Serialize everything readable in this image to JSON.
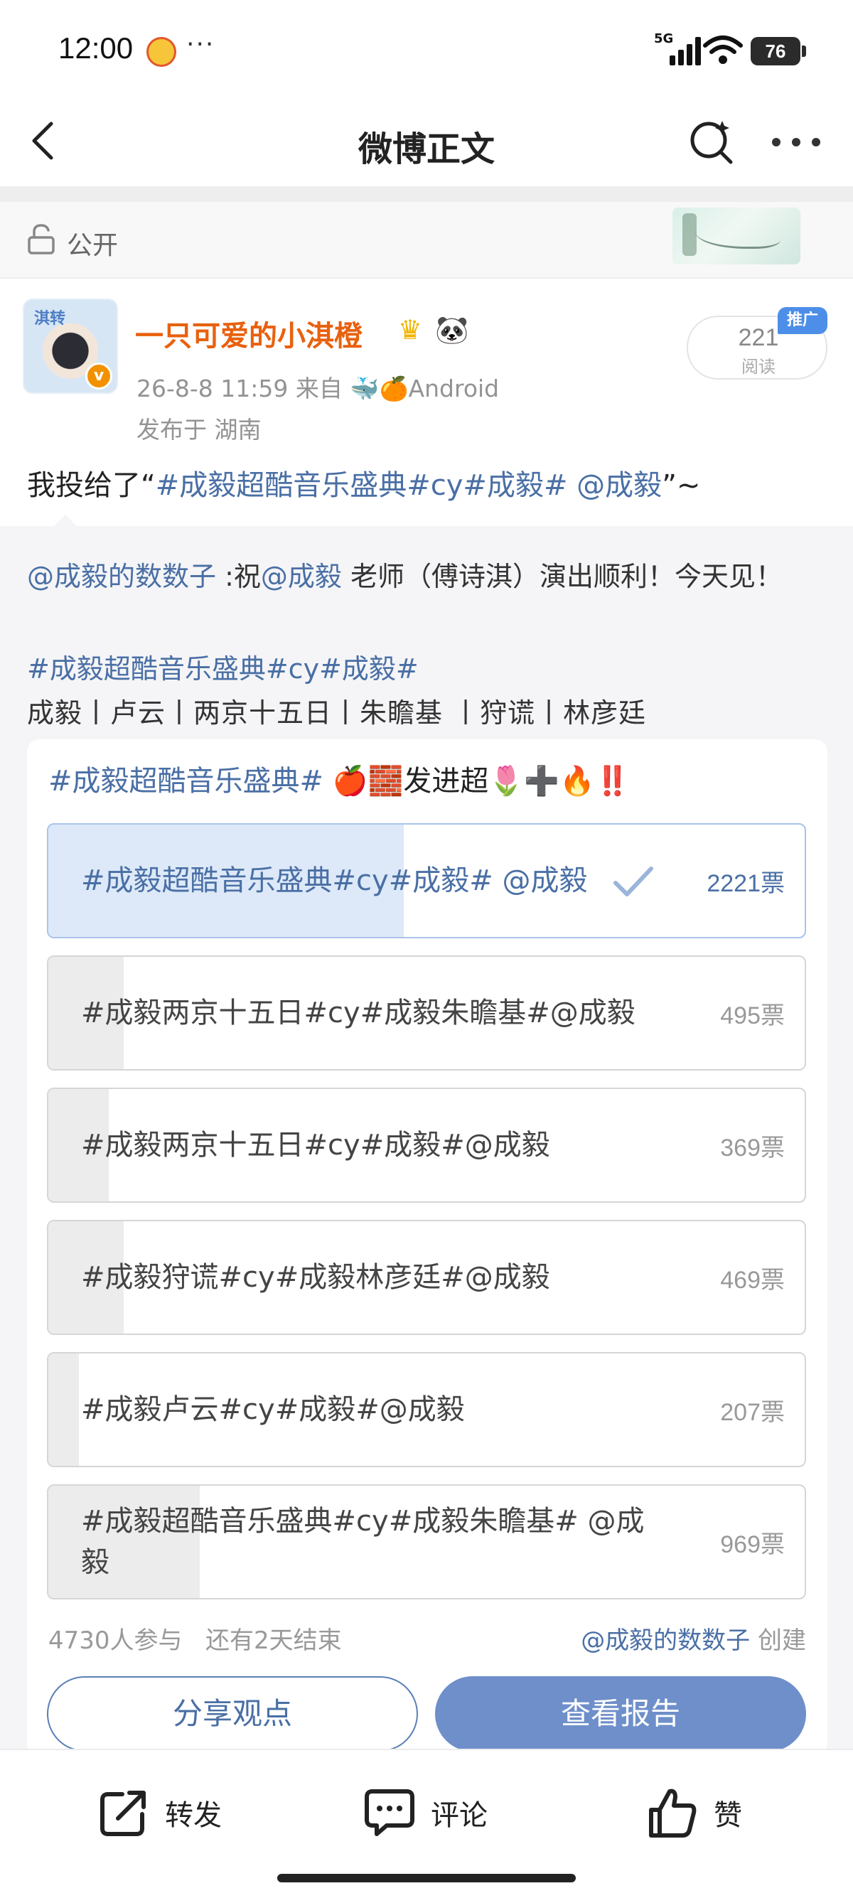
{
  "status_bar": {
    "time": "12:00",
    "dots": "···",
    "network": "5G",
    "battery": "76"
  },
  "nav": {
    "title": "微博正文"
  },
  "visibility": {
    "label": "公开"
  },
  "author": {
    "name": "一只可爱的小淇橙",
    "avatar_text": "淇转",
    "verified": "v",
    "meta": "26-8-8 11:59   来自 🐳🍊Android",
    "location": "发布于 湖南",
    "reads": "221",
    "reads_label": "阅读",
    "promo": "推广"
  },
  "post": {
    "prefix": "我投给了“",
    "link": "#成毅超酷音乐盛典#cy#成毅# @成毅",
    "suffix": "”~"
  },
  "repost": {
    "line1_mention": "@成毅的数数子",
    "line1_a": " :祝",
    "line1_mention2": "@成毅",
    "line1_b": " 老师（傅诗淇）演出顺利！今天见！",
    "tags": "#成毅超酷音乐盛典#cy#成毅#",
    "names": "成毅丨卢云丨两京十五日丨朱瞻基 丨狩谎丨林彦廷"
  },
  "poll": {
    "title_tag": "#成毅超酷音乐盛典#",
    "title_rest": " 🍎🧱发进超🌷➕🔥‼️",
    "options": [
      {
        "text": "#成毅超酷音乐盛典#cy#成毅# @成毅",
        "votes": "2221票",
        "share": 0.47,
        "selected": true
      },
      {
        "text": "#成毅两京十五日#cy#成毅朱瞻基#@成毅",
        "votes": "495票",
        "share": 0.1,
        "selected": false
      },
      {
        "text": "#成毅两京十五日#cy#成毅#@成毅",
        "votes": "369票",
        "share": 0.08,
        "selected": false
      },
      {
        "text": "#成毅狩谎#cy#成毅林彦廷#@成毅",
        "votes": "469票",
        "share": 0.1,
        "selected": false
      },
      {
        "text": "#成毅卢云#cy#成毅#@成毅",
        "votes": "207票",
        "share": 0.04,
        "selected": false
      },
      {
        "text": "#成毅超酷音乐盛典#cy#成毅朱瞻基# @成毅",
        "votes": "969票",
        "share": 0.2,
        "selected": false
      }
    ],
    "participants": "4730人参与",
    "remaining": "还有2天结束",
    "creator": "@成毅的数数子",
    "creator_suffix": " 创建",
    "share_button": "分享观点",
    "report_button": "查看报告"
  },
  "actions": {
    "repost": "转发",
    "comment": "评论",
    "like": "赞"
  },
  "colors": {
    "link": "#4a6fa5",
    "username": "#e8610e",
    "report_button": "#6e8fca"
  }
}
